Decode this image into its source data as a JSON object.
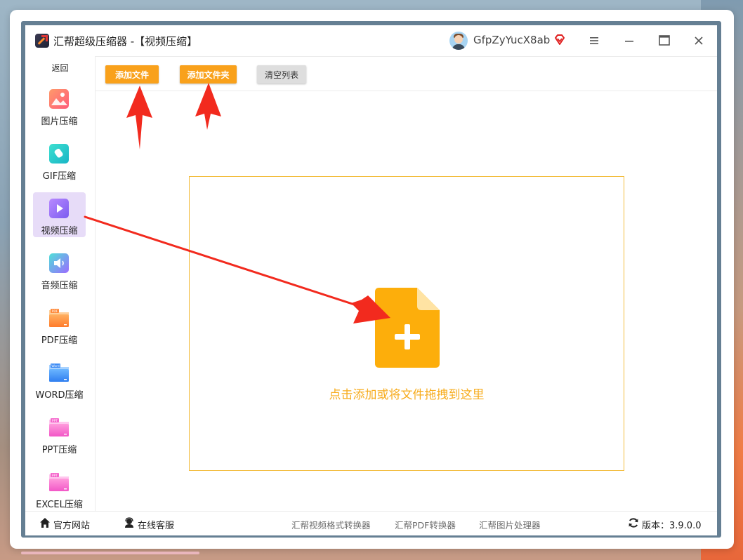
{
  "window": {
    "title": "汇帮超级压缩器  -【视频压缩】",
    "username": "GfpZyYucX8ab",
    "controls": [
      "menu-icon",
      "minimize-icon",
      "maximize-icon",
      "close-icon"
    ]
  },
  "sidebar": {
    "back_label": "返回",
    "items": [
      {
        "label": "图片压缩",
        "icon": "image-icon",
        "active": false
      },
      {
        "label": "GIF压缩",
        "icon": "gif-icon",
        "active": false
      },
      {
        "label": "视频压缩",
        "icon": "video-icon",
        "active": true
      },
      {
        "label": "音频压缩",
        "icon": "audio-icon",
        "active": false
      },
      {
        "label": "PDF压缩",
        "icon": "pdf-folder-icon",
        "active": false
      },
      {
        "label": "WORD压缩",
        "icon": "word-folder-icon",
        "active": false
      },
      {
        "label": "PPT压缩",
        "icon": "ppt-folder-icon",
        "active": false
      },
      {
        "label": "EXCEL压缩",
        "icon": "excel-folder-icon",
        "active": false
      }
    ]
  },
  "toolbar": {
    "add_file_label": "添加文件",
    "add_folder_label": "添加文件夹",
    "clear_label": "清空列表"
  },
  "dropzone": {
    "hint": "点击添加或将文件拖拽到这里"
  },
  "footer": {
    "website_label": "官方网站",
    "service_label": "在线客服",
    "links": [
      "汇帮视频格式转换器",
      "汇帮PDF转换器",
      "汇帮图片处理器"
    ],
    "version_label": "版本：3.9.0.0"
  },
  "colors": {
    "accent_orange": "#f9a11b",
    "dropzone_border": "#f3bd3e",
    "active_nav_bg": "#e7dcf8",
    "frame": "#657f93",
    "annotation_arrow": "#f22a1e"
  }
}
